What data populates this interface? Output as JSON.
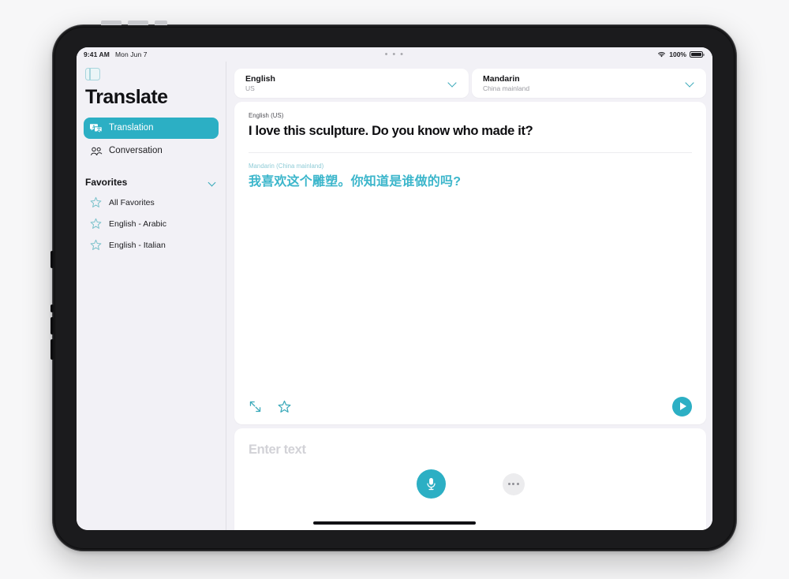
{
  "statusbar": {
    "time": "9:41 AM",
    "date": "Mon Jun 7",
    "multitask_dots": "• • •",
    "battery_percent": "100%",
    "wifi_icon": "wifi-icon",
    "battery_icon": "battery-icon"
  },
  "sidebar": {
    "toggle_icon": "sidebar-toggle-icon",
    "title": "Translate",
    "nav": [
      {
        "label": "Translation",
        "icon": "translation-bubbles-icon",
        "active": true
      },
      {
        "label": "Conversation",
        "icon": "two-people-icon",
        "active": false
      }
    ],
    "favorites": {
      "heading": "Favorites",
      "chevron_icon": "chevron-down-icon",
      "items": [
        {
          "label": "All Favorites",
          "icon": "star-icon"
        },
        {
          "label": "English - Arabic",
          "icon": "star-icon"
        },
        {
          "label": "English - Italian",
          "icon": "star-icon"
        }
      ]
    }
  },
  "main": {
    "source_selector": {
      "language": "English",
      "region": "US",
      "chevron_icon": "chevron-down-icon"
    },
    "target_selector": {
      "language": "Mandarin",
      "region": "China mainland",
      "chevron_icon": "chevron-down-icon"
    },
    "translation_card": {
      "source_label": "English (US)",
      "source_text": "I love this sculpture. Do you know who made it?",
      "target_label": "Mandarin (China mainland)",
      "target_text": "我喜欢这个雕塑。你知道是谁做的吗?",
      "actions": {
        "expand_icon": "expand-arrows-icon",
        "favorite_icon": "star-icon",
        "play_icon": "play-icon"
      }
    },
    "input_card": {
      "placeholder": "Enter text",
      "mic_icon": "microphone-icon",
      "more_icon": "more-ellipsis-icon"
    }
  },
  "colors": {
    "accent_teal": "#2CAFC4",
    "target_text": "#3cb6cb",
    "screen_bg": "#f2f1f6",
    "card_bg": "#ffffff"
  }
}
